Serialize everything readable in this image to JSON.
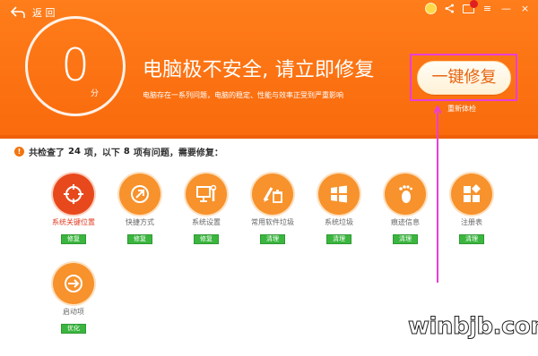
{
  "header": {
    "back_label": "返 回",
    "score_value": "0",
    "score_unit": "分",
    "headline": "电脑极不安全, 请立即修复",
    "subline": "电脑存在一系列问题，电脑的稳定、性能与效率正受到严重影响",
    "fix_button_label": "一键修复",
    "recheck_label": "重新体检",
    "window_controls": [
      "medal-icon",
      "share-icon",
      "mail-icon",
      "menu-icon",
      "minimize-icon",
      "close-icon"
    ]
  },
  "summary": {
    "prefix": "共检查了",
    "total": "24",
    "middle": "项，以下",
    "issues": "8",
    "suffix": "项有问题，需要修复："
  },
  "items": [
    {
      "label": "系统关键位置",
      "action": "修复",
      "icon": "target-icon",
      "critical": true
    },
    {
      "label": "快捷方式",
      "action": "修复",
      "icon": "shortcut-icon",
      "critical": false
    },
    {
      "label": "系统设置",
      "action": "修复",
      "icon": "monitor-wrench-icon",
      "critical": false
    },
    {
      "label": "常用软件垃圾",
      "action": "清理",
      "icon": "brush-trash-icon",
      "critical": false
    },
    {
      "label": "系统垃圾",
      "action": "清理",
      "icon": "windows-icon",
      "critical": false
    },
    {
      "label": "痕迹信息",
      "action": "清理",
      "icon": "footprint-icon",
      "critical": false
    },
    {
      "label": "注册表",
      "action": "清理",
      "icon": "registry-icon",
      "critical": false
    },
    {
      "label": "启动项",
      "action": "优化",
      "icon": "startup-arrow-icon",
      "critical": false
    }
  ],
  "watermark": "winbjb.com",
  "colors": {
    "header_orange": "#f96a0c",
    "item_orange": "#f7922c",
    "critical_red": "#e8491c",
    "action_green": "#3bb53f",
    "highlight_magenta": "#ea3ed7"
  }
}
